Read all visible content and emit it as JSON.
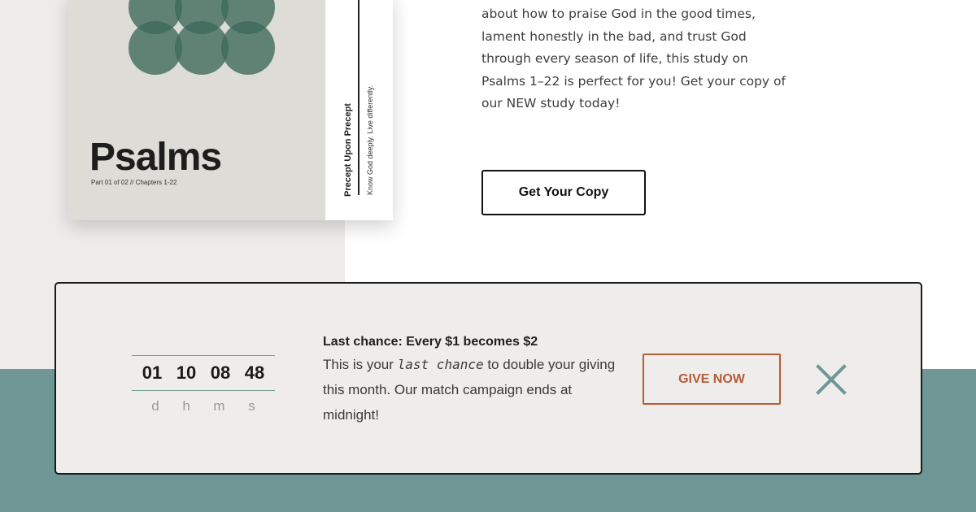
{
  "book": {
    "title": "Psalms",
    "subtitle": "Part 01 of 02  //  Chapters 1-22",
    "spine_title": "Precept Upon Precept",
    "spine_tagline": "Know God deeply. Live differently."
  },
  "promo": {
    "lines": [
      "about how to praise God in the good times,",
      "lament honestly in the bad, and trust God",
      "through every season of life, this study on",
      "Psalms 1–22 is perfect for you! Get your copy of",
      "our NEW study today!"
    ],
    "cta_label": "Get Your Copy"
  },
  "banner": {
    "countdown": {
      "days": "01",
      "hours": "10",
      "minutes": "08",
      "seconds": "48",
      "unit_days": "d",
      "unit_hours": "h",
      "unit_minutes": "m",
      "unit_seconds": "s"
    },
    "headline": "Last chance: Every $1 becomes $2",
    "body_before": "This is your ",
    "body_emphasis": "last chance",
    "body_after": " to double your giving this month. Our match campaign ends at midnight!",
    "give_label": "GIVE NOW",
    "close_icon": "close-x-icon"
  },
  "colors": {
    "teal": "#6e9796",
    "accent_orange": "#b55c39",
    "panel_bg": "#eeedeb"
  }
}
